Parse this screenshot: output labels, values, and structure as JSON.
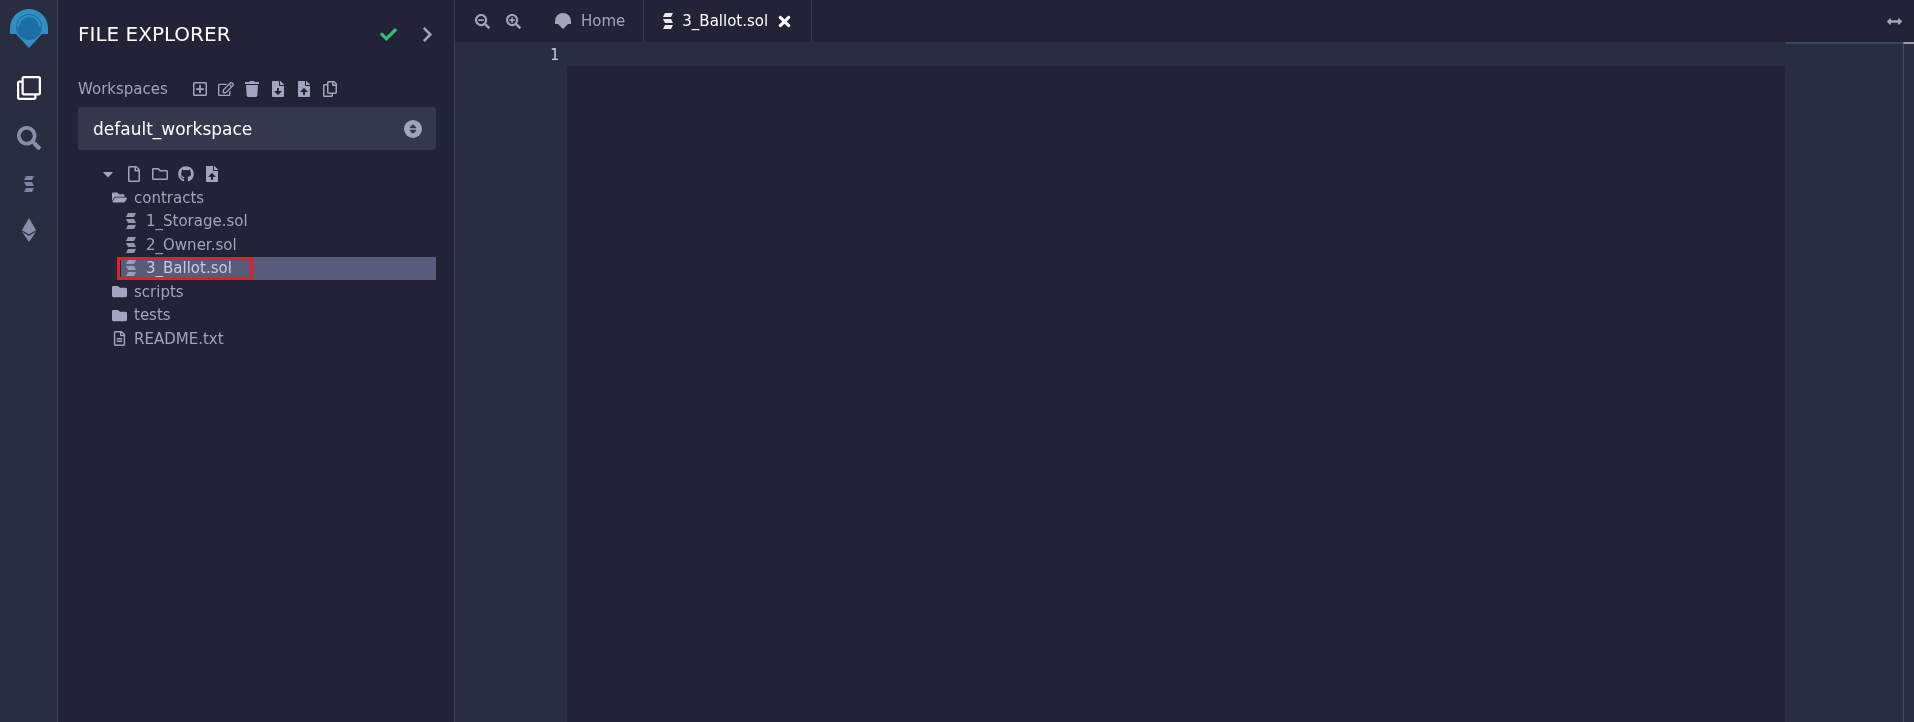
{
  "panel": {
    "title": "FILE EXPLORER"
  },
  "workspaces": {
    "label": "Workspaces",
    "value": "default_workspace"
  },
  "tree": [
    {
      "kind": "folder",
      "name": "contracts",
      "expanded": true,
      "children": [
        {
          "kind": "sol",
          "name": "1_Storage.sol",
          "selected": false,
          "highlighted": false
        },
        {
          "kind": "sol",
          "name": "2_Owner.sol",
          "selected": false,
          "highlighted": false
        },
        {
          "kind": "sol",
          "name": "3_Ballot.sol",
          "selected": true,
          "highlighted": true
        }
      ]
    },
    {
      "kind": "folder",
      "name": "scripts",
      "expanded": false
    },
    {
      "kind": "folder",
      "name": "tests",
      "expanded": false
    },
    {
      "kind": "file",
      "name": "README.txt"
    }
  ],
  "tabs": [
    {
      "kind": "home",
      "label": "Home",
      "selected": false
    },
    {
      "kind": "sol",
      "label": "3_Ballot.sol",
      "selected": true
    }
  ],
  "editor": {
    "line_numbers": [
      "1"
    ]
  }
}
